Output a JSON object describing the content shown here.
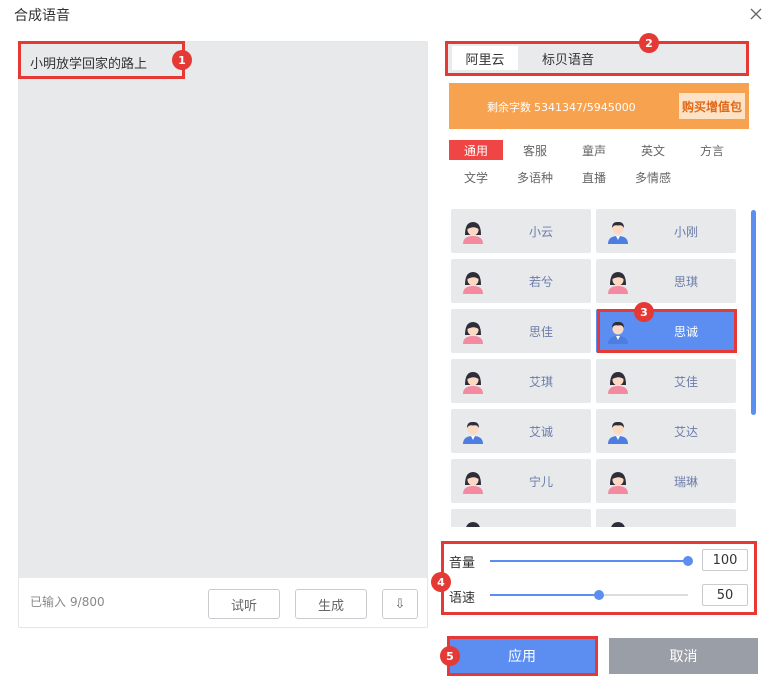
{
  "dialog": {
    "title": "合成语音",
    "close_icon": "close-icon"
  },
  "editor": {
    "text": "小明放学回家的路上",
    "count_label": "已输入",
    "count_value": "9/800",
    "listen_label": "试听",
    "generate_label": "生成",
    "download_icon": "download-icon",
    "download_glyph": "⇩"
  },
  "providers": {
    "tabs": [
      {
        "label": "阿里云",
        "active": true
      },
      {
        "label": "标贝语音",
        "active": false
      }
    ]
  },
  "quota": {
    "label": "剩余字数",
    "value": "5341347/5945000",
    "buy_label": "购买增值包"
  },
  "categories": [
    {
      "label": "通用",
      "active": true
    },
    {
      "label": "客服"
    },
    {
      "label": "童声"
    },
    {
      "label": "英文"
    },
    {
      "label": "方言"
    },
    {
      "label": "文学"
    },
    {
      "label": "多语种"
    },
    {
      "label": "直播"
    },
    {
      "label": "多情感"
    }
  ],
  "voices": [
    {
      "name": "小云",
      "gender": "female"
    },
    {
      "name": "小刚",
      "gender": "male"
    },
    {
      "name": "若兮",
      "gender": "female"
    },
    {
      "name": "思琪",
      "gender": "female"
    },
    {
      "name": "思佳",
      "gender": "female"
    },
    {
      "name": "思诚",
      "gender": "male",
      "selected": true
    },
    {
      "name": "艾琪",
      "gender": "female"
    },
    {
      "name": "艾佳",
      "gender": "female"
    },
    {
      "name": "艾诚",
      "gender": "male"
    },
    {
      "name": "艾达",
      "gender": "male"
    },
    {
      "name": "宁儿",
      "gender": "female"
    },
    {
      "name": "瑞琳",
      "gender": "female"
    },
    {
      "name": "",
      "gender": "female"
    },
    {
      "name": "",
      "gender": "female"
    }
  ],
  "params": {
    "volume": {
      "label": "音量",
      "value": "100",
      "level": 1.0
    },
    "speed": {
      "label": "语速",
      "value": "50",
      "level": 0.55
    }
  },
  "actions": {
    "apply_label": "应用",
    "cancel_label": "取消"
  },
  "annotations": [
    "1",
    "2",
    "3",
    "4",
    "5"
  ],
  "colors": {
    "accent_blue": "#5b8ef0",
    "highlight_red": "#e53935",
    "category_active": "#f04545",
    "quota_orange": "#f7a24e",
    "cancel_gray": "#9a9ea6"
  }
}
